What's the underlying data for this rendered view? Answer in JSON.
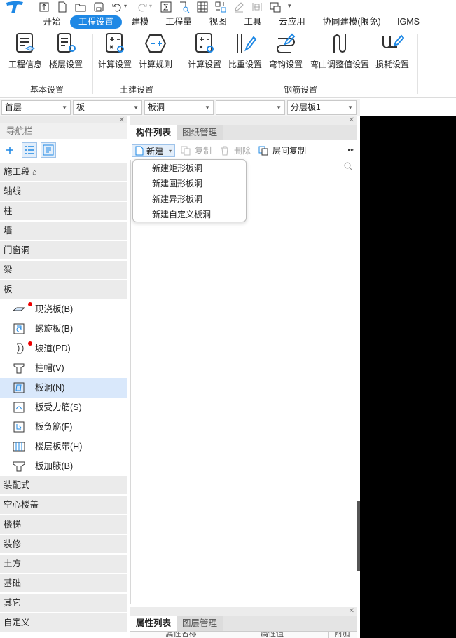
{
  "quick_toolbar": {
    "icons": [
      "app-logo",
      "import-icon",
      "new-file-icon",
      "open-folder-icon",
      "save-icon",
      "undo-icon",
      "redo-icon",
      "sum-icon",
      "find-icon",
      "grid-icon",
      "settings-icon",
      "pen-icon",
      "ruler-icon",
      "screen-icon",
      "dropdown-icon"
    ]
  },
  "menu_tabs": [
    {
      "label": "开始",
      "active": false
    },
    {
      "label": "工程设置",
      "active": true
    },
    {
      "label": "建模",
      "active": false
    },
    {
      "label": "工程量",
      "active": false
    },
    {
      "label": "视图",
      "active": false
    },
    {
      "label": "工具",
      "active": false
    },
    {
      "label": "云应用",
      "active": false
    },
    {
      "label": "协同建模(限免)",
      "active": false
    },
    {
      "label": "IGMS",
      "active": false
    }
  ],
  "ribbon": {
    "groups": [
      {
        "label": "基本设置",
        "buttons": [
          {
            "label": "工程信息"
          },
          {
            "label": "楼层设置"
          }
        ]
      },
      {
        "label": "土建设置",
        "buttons": [
          {
            "label": "计算设置"
          },
          {
            "label": "计算规则"
          }
        ]
      },
      {
        "label": "钢筋设置",
        "buttons": [
          {
            "label": "计算设置"
          },
          {
            "label": "比重设置"
          },
          {
            "label": "弯钩设置"
          },
          {
            "label": "弯曲调整值设置"
          },
          {
            "label": "损耗设置"
          }
        ]
      }
    ]
  },
  "selectors": [
    {
      "value": "首层"
    },
    {
      "value": "板"
    },
    {
      "value": "板洞"
    },
    {
      "value": ""
    },
    {
      "value": "分层板1"
    }
  ],
  "nav": {
    "title": "导航栏",
    "categories_top": [
      "施工段",
      "轴线",
      "柱",
      "墙",
      "门窗洞",
      "梁",
      "板"
    ],
    "board_items": [
      {
        "label": "现浇板(B)",
        "dot": true,
        "selected": false,
        "icon": "cast-slab-icon"
      },
      {
        "label": "螺旋板(B)",
        "dot": false,
        "selected": false,
        "icon": "spiral-slab-icon"
      },
      {
        "label": "坡道(PD)",
        "dot": true,
        "selected": false,
        "icon": "ramp-icon"
      },
      {
        "label": "柱帽(V)",
        "dot": false,
        "selected": false,
        "icon": "column-cap-icon"
      },
      {
        "label": "板洞(N)",
        "dot": false,
        "selected": true,
        "icon": "slab-hole-icon"
      },
      {
        "label": "板受力筋(S)",
        "dot": false,
        "selected": false,
        "icon": "slab-rebar-icon"
      },
      {
        "label": "板负筋(F)",
        "dot": false,
        "selected": false,
        "icon": "negative-rebar-icon"
      },
      {
        "label": "楼层板带(H)",
        "dot": false,
        "selected": false,
        "icon": "slab-strip-icon"
      },
      {
        "label": "板加腋(B)",
        "dot": false,
        "selected": false,
        "icon": "slab-haunch-icon"
      }
    ],
    "categories_bottom": [
      "装配式",
      "空心楼盖",
      "楼梯",
      "装修",
      "土方",
      "基础",
      "其它",
      "自定义"
    ]
  },
  "component_panel": {
    "tabs": [
      {
        "label": "构件列表",
        "active": true
      },
      {
        "label": "图纸管理",
        "active": false
      }
    ],
    "toolbar": {
      "new": "新建",
      "copy": "复制",
      "delete": "删除",
      "floor_copy": "层间复制"
    },
    "dropdown": [
      "新建矩形板洞",
      "新建圆形板洞",
      "新建异形板洞",
      "新建自定义板洞"
    ]
  },
  "property_panel": {
    "tabs": [
      {
        "label": "属性列表",
        "active": true
      },
      {
        "label": "图层管理",
        "active": false
      }
    ],
    "columns": [
      "属性名称",
      "属性值",
      "附加"
    ]
  },
  "colors": {
    "accent": "#1e88e5",
    "selected_row": "#d9e8fb",
    "category_bg": "#ebebeb",
    "dot": "#e00000",
    "dark_pane": "#000000"
  }
}
